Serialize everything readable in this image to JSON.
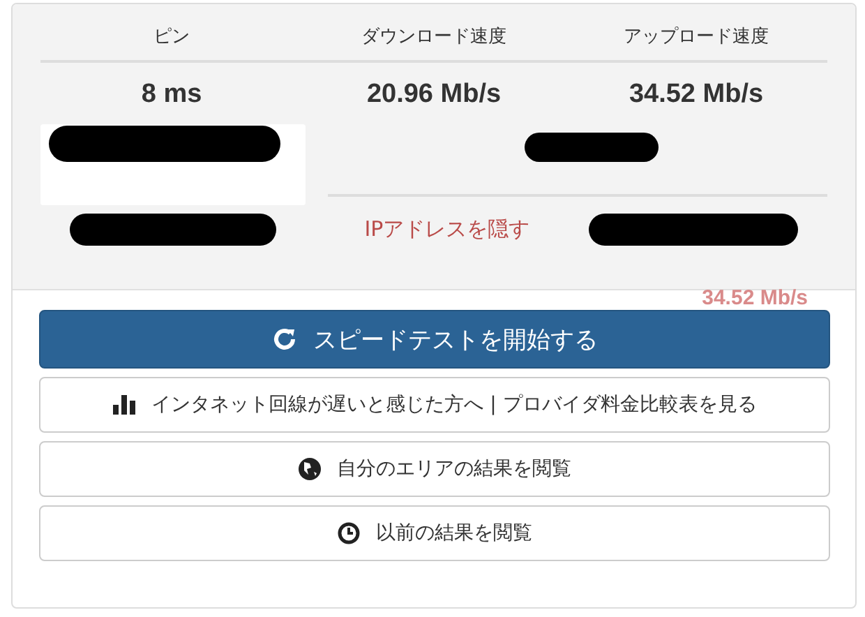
{
  "stats": [
    {
      "label": "ピン",
      "value": "8 ms"
    },
    {
      "label": "ダウンロード速度",
      "value": "20.96 Mb/s"
    },
    {
      "label": "アップロード速度",
      "value": "34.52 Mb/s"
    }
  ],
  "hide_ip_link": "IPアドレスを隠す",
  "ghost_text": "34.52 Mb/s",
  "buttons": [
    {
      "kind": "primary",
      "label": "スピードテストを開始する"
    },
    {
      "kind": "default",
      "label": "インタネット回線が遅いと感じた方へ | プロバイダ料金比較表を見る"
    },
    {
      "kind": "default",
      "label": "自分のエリアの結果を閲覧"
    },
    {
      "kind": "default",
      "label": "以前の結果を閲覧"
    }
  ]
}
